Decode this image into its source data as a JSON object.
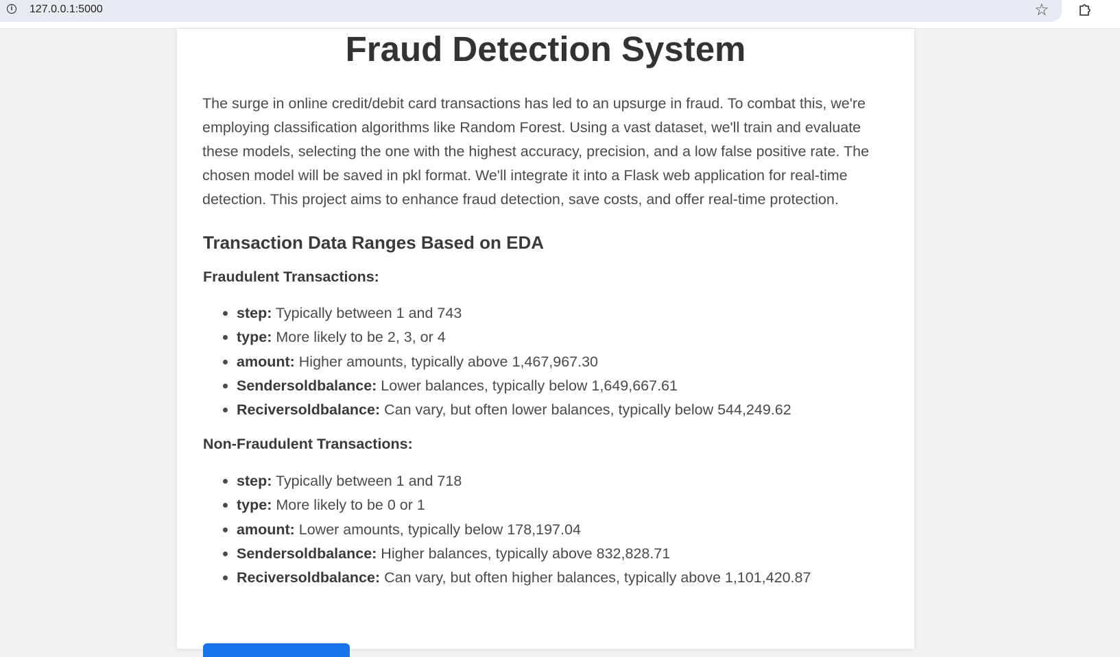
{
  "browser": {
    "url": "127.0.0.1:5000",
    "info_icon": "info-icon",
    "bookmark_icon": "star-icon",
    "extensions_icon": "puzzle-icon"
  },
  "page": {
    "title": "Fraud Detection System",
    "intro": "The surge in online credit/debit card transactions has led to an upsurge in fraud. To combat this, we're employing classification algorithms like Random Forest. Using a vast dataset, we'll train and evaluate these models, selecting the one with the highest accuracy, precision, and a low false positive rate. The chosen model will be saved in pkl format. We'll integrate it into a Flask web application for real-time detection. This project aims to enhance fraud detection, save costs, and offer real-time protection.",
    "section_title": "Transaction Data Ranges Based on EDA",
    "fraudulent": {
      "heading": "Fraudulent Transactions:",
      "items": [
        {
          "key": "step:",
          "text": " Typically between 1 and 743"
        },
        {
          "key": "type:",
          "text": " More likely to be 2, 3, or 4"
        },
        {
          "key": "amount:",
          "text": " Higher amounts, typically above 1,467,967.30"
        },
        {
          "key": "Sendersoldbalance:",
          "text": " Lower balances, typically below 1,649,667.61"
        },
        {
          "key": "Reciversoldbalance:",
          "text": " Can vary, but often lower balances, typically below 544,249.62"
        }
      ]
    },
    "non_fraudulent": {
      "heading": "Non-Fraudulent Transactions:",
      "items": [
        {
          "key": "step:",
          "text": " Typically between 1 and 718"
        },
        {
          "key": "type:",
          "text": " More likely to be 0 or 1"
        },
        {
          "key": "amount:",
          "text": " Lower amounts, typically below 178,197.04"
        },
        {
          "key": "Sendersoldbalance:",
          "text": " Higher balances, typically above 832,828.71"
        },
        {
          "key": "Reciversoldbalance:",
          "text": " Can vary, but often higher balances, typically above 1,101,420.87"
        }
      ]
    },
    "accent_color": "#1a73e8"
  }
}
